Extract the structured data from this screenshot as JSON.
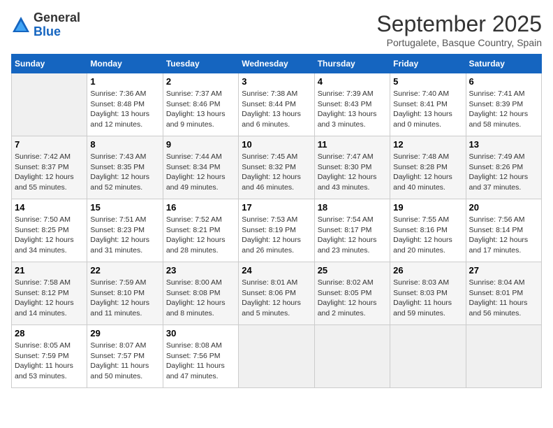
{
  "logo": {
    "general": "General",
    "blue": "Blue"
  },
  "title": "September 2025",
  "subtitle": "Portugalete, Basque Country, Spain",
  "headers": [
    "Sunday",
    "Monday",
    "Tuesday",
    "Wednesday",
    "Thursday",
    "Friday",
    "Saturday"
  ],
  "weeks": [
    [
      {
        "num": "",
        "info": ""
      },
      {
        "num": "1",
        "info": "Sunrise: 7:36 AM\nSunset: 8:48 PM\nDaylight: 13 hours\nand 12 minutes."
      },
      {
        "num": "2",
        "info": "Sunrise: 7:37 AM\nSunset: 8:46 PM\nDaylight: 13 hours\nand 9 minutes."
      },
      {
        "num": "3",
        "info": "Sunrise: 7:38 AM\nSunset: 8:44 PM\nDaylight: 13 hours\nand 6 minutes."
      },
      {
        "num": "4",
        "info": "Sunrise: 7:39 AM\nSunset: 8:43 PM\nDaylight: 13 hours\nand 3 minutes."
      },
      {
        "num": "5",
        "info": "Sunrise: 7:40 AM\nSunset: 8:41 PM\nDaylight: 13 hours\nand 0 minutes."
      },
      {
        "num": "6",
        "info": "Sunrise: 7:41 AM\nSunset: 8:39 PM\nDaylight: 12 hours\nand 58 minutes."
      }
    ],
    [
      {
        "num": "7",
        "info": "Sunrise: 7:42 AM\nSunset: 8:37 PM\nDaylight: 12 hours\nand 55 minutes."
      },
      {
        "num": "8",
        "info": "Sunrise: 7:43 AM\nSunset: 8:35 PM\nDaylight: 12 hours\nand 52 minutes."
      },
      {
        "num": "9",
        "info": "Sunrise: 7:44 AM\nSunset: 8:34 PM\nDaylight: 12 hours\nand 49 minutes."
      },
      {
        "num": "10",
        "info": "Sunrise: 7:45 AM\nSunset: 8:32 PM\nDaylight: 12 hours\nand 46 minutes."
      },
      {
        "num": "11",
        "info": "Sunrise: 7:47 AM\nSunset: 8:30 PM\nDaylight: 12 hours\nand 43 minutes."
      },
      {
        "num": "12",
        "info": "Sunrise: 7:48 AM\nSunset: 8:28 PM\nDaylight: 12 hours\nand 40 minutes."
      },
      {
        "num": "13",
        "info": "Sunrise: 7:49 AM\nSunset: 8:26 PM\nDaylight: 12 hours\nand 37 minutes."
      }
    ],
    [
      {
        "num": "14",
        "info": "Sunrise: 7:50 AM\nSunset: 8:25 PM\nDaylight: 12 hours\nand 34 minutes."
      },
      {
        "num": "15",
        "info": "Sunrise: 7:51 AM\nSunset: 8:23 PM\nDaylight: 12 hours\nand 31 minutes."
      },
      {
        "num": "16",
        "info": "Sunrise: 7:52 AM\nSunset: 8:21 PM\nDaylight: 12 hours\nand 28 minutes."
      },
      {
        "num": "17",
        "info": "Sunrise: 7:53 AM\nSunset: 8:19 PM\nDaylight: 12 hours\nand 26 minutes."
      },
      {
        "num": "18",
        "info": "Sunrise: 7:54 AM\nSunset: 8:17 PM\nDaylight: 12 hours\nand 23 minutes."
      },
      {
        "num": "19",
        "info": "Sunrise: 7:55 AM\nSunset: 8:16 PM\nDaylight: 12 hours\nand 20 minutes."
      },
      {
        "num": "20",
        "info": "Sunrise: 7:56 AM\nSunset: 8:14 PM\nDaylight: 12 hours\nand 17 minutes."
      }
    ],
    [
      {
        "num": "21",
        "info": "Sunrise: 7:58 AM\nSunset: 8:12 PM\nDaylight: 12 hours\nand 14 minutes."
      },
      {
        "num": "22",
        "info": "Sunrise: 7:59 AM\nSunset: 8:10 PM\nDaylight: 12 hours\nand 11 minutes."
      },
      {
        "num": "23",
        "info": "Sunrise: 8:00 AM\nSunset: 8:08 PM\nDaylight: 12 hours\nand 8 minutes."
      },
      {
        "num": "24",
        "info": "Sunrise: 8:01 AM\nSunset: 8:06 PM\nDaylight: 12 hours\nand 5 minutes."
      },
      {
        "num": "25",
        "info": "Sunrise: 8:02 AM\nSunset: 8:05 PM\nDaylight: 12 hours\nand 2 minutes."
      },
      {
        "num": "26",
        "info": "Sunrise: 8:03 AM\nSunset: 8:03 PM\nDaylight: 11 hours\nand 59 minutes."
      },
      {
        "num": "27",
        "info": "Sunrise: 8:04 AM\nSunset: 8:01 PM\nDaylight: 11 hours\nand 56 minutes."
      }
    ],
    [
      {
        "num": "28",
        "info": "Sunrise: 8:05 AM\nSunset: 7:59 PM\nDaylight: 11 hours\nand 53 minutes."
      },
      {
        "num": "29",
        "info": "Sunrise: 8:07 AM\nSunset: 7:57 PM\nDaylight: 11 hours\nand 50 minutes."
      },
      {
        "num": "30",
        "info": "Sunrise: 8:08 AM\nSunset: 7:56 PM\nDaylight: 11 hours\nand 47 minutes."
      },
      {
        "num": "",
        "info": ""
      },
      {
        "num": "",
        "info": ""
      },
      {
        "num": "",
        "info": ""
      },
      {
        "num": "",
        "info": ""
      }
    ]
  ]
}
